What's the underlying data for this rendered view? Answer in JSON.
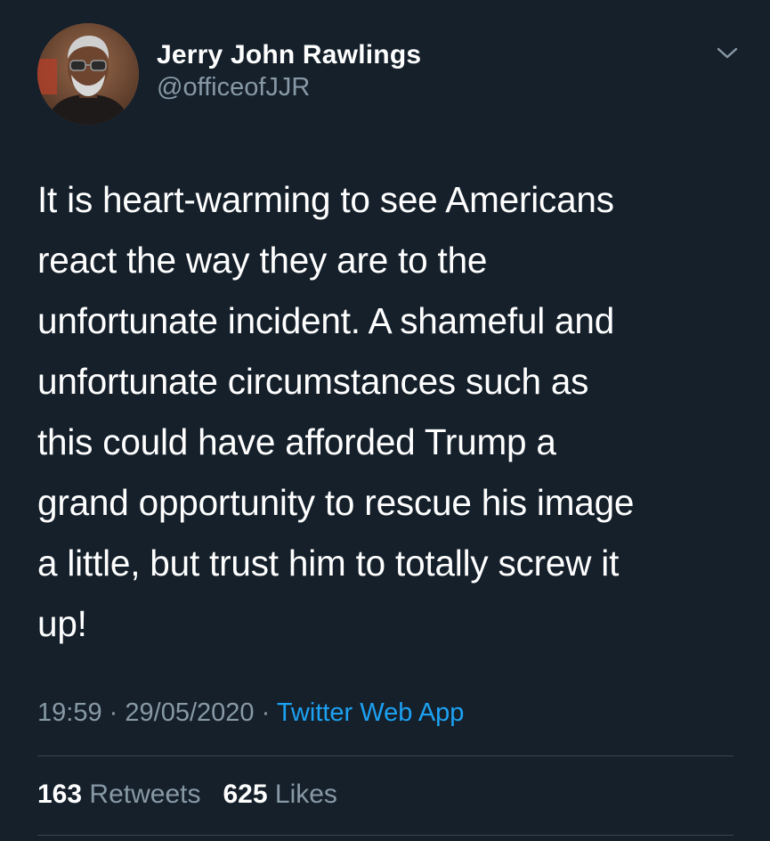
{
  "author": {
    "display_name": "Jerry John Rawlings",
    "handle": "@officeofJJR",
    "avatar_icon": "profile-photo"
  },
  "tweet": {
    "text": "It is heart-warming to see Americans\nreact the way they are to the\nunfortunate incident. A shameful and\nunfortunate circumstances such as\nthis could have afforded Trump a\ngrand opportunity to rescue his image\na little, but trust him to totally screw it\nup!"
  },
  "meta": {
    "time": "19:59",
    "separator": "·",
    "date": "29/05/2020",
    "source": "Twitter Web App"
  },
  "stats": {
    "retweets_count": "163",
    "retweets_label": "Retweets",
    "likes_count": "625",
    "likes_label": "Likes"
  },
  "colors": {
    "background": "#15202b",
    "secondary_text": "#8899a6",
    "link": "#1da1f2",
    "divider": "#38444d"
  },
  "icons": {
    "menu": "chevron-down-icon"
  }
}
